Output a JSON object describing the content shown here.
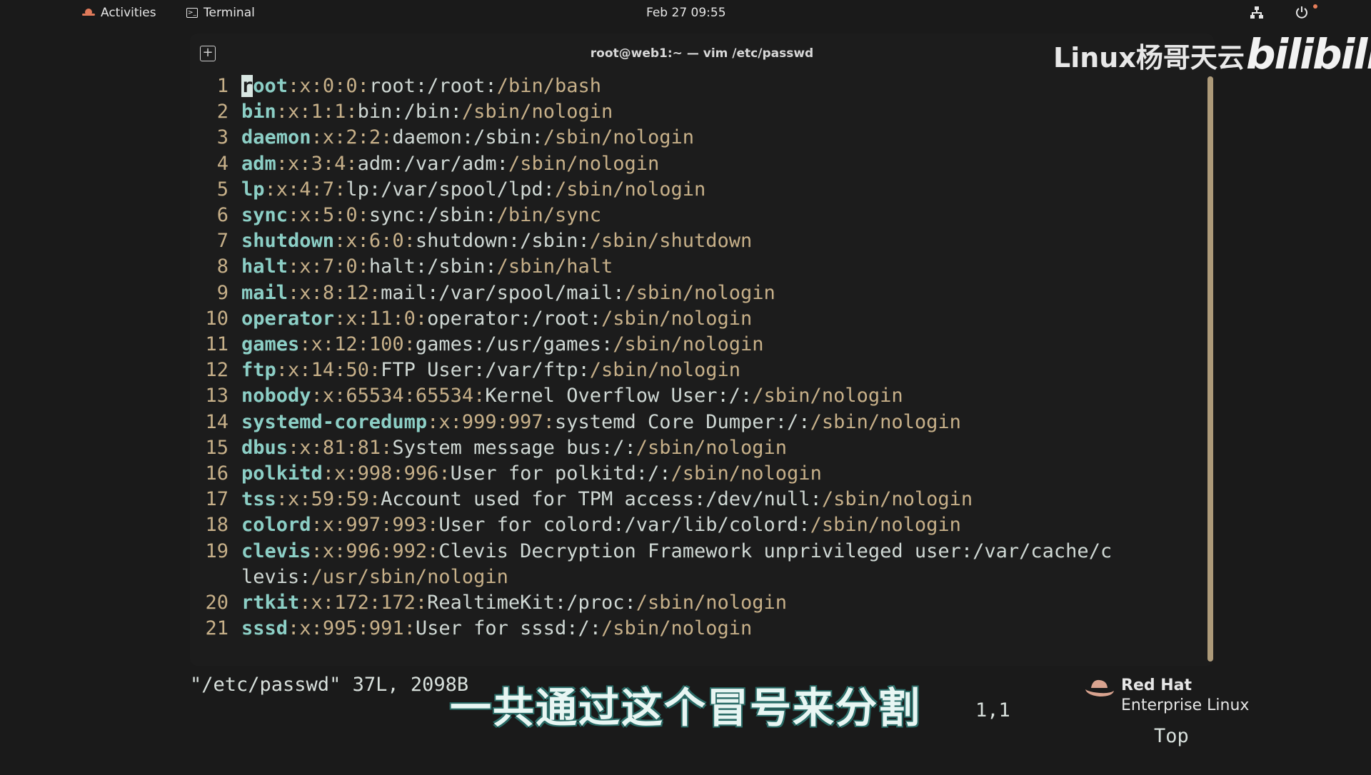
{
  "topbar": {
    "activities_label": "Activities",
    "app_label": "Terminal",
    "clock": "Feb 27  09:55"
  },
  "window": {
    "title": "root@web1:~ — vim /etc/passwd"
  },
  "watermark": {
    "text": "Linux杨哥天云",
    "logo": "bilibili"
  },
  "vim": {
    "lines": [
      {
        "num": "1",
        "user": "root",
        "rest": [
          [
            "s",
            ":x:"
          ],
          [
            "n",
            "0:0"
          ],
          [
            "s",
            ":"
          ],
          [
            "f",
            "root:/root:"
          ],
          [
            "sh",
            "/bin/bash"
          ]
        ]
      },
      {
        "num": "2",
        "user": "bin",
        "rest": [
          [
            "s",
            ":x:"
          ],
          [
            "n",
            "1:1"
          ],
          [
            "s",
            ":"
          ],
          [
            "f",
            "bin:/bin:"
          ],
          [
            "sh",
            "/sbin/nologin"
          ]
        ]
      },
      {
        "num": "3",
        "user": "daemon",
        "rest": [
          [
            "s",
            ":x:"
          ],
          [
            "n",
            "2:2"
          ],
          [
            "s",
            ":"
          ],
          [
            "f",
            "daemon:/sbin:"
          ],
          [
            "sh",
            "/sbin/nologin"
          ]
        ]
      },
      {
        "num": "4",
        "user": "adm",
        "rest": [
          [
            "s",
            ":x:"
          ],
          [
            "n",
            "3:4"
          ],
          [
            "s",
            ":"
          ],
          [
            "f",
            "adm:/var/adm:"
          ],
          [
            "sh",
            "/sbin/nologin"
          ]
        ]
      },
      {
        "num": "5",
        "user": "lp",
        "rest": [
          [
            "s",
            ":x:"
          ],
          [
            "n",
            "4:7"
          ],
          [
            "s",
            ":"
          ],
          [
            "f",
            "lp:/var/spool/lpd:"
          ],
          [
            "sh",
            "/sbin/nologin"
          ]
        ]
      },
      {
        "num": "6",
        "user": "sync",
        "rest": [
          [
            "s",
            ":x:"
          ],
          [
            "n",
            "5:0"
          ],
          [
            "s",
            ":"
          ],
          [
            "f",
            "sync:/sbin:"
          ],
          [
            "sh",
            "/bin/sync"
          ]
        ]
      },
      {
        "num": "7",
        "user": "shutdown",
        "rest": [
          [
            "s",
            ":x:"
          ],
          [
            "n",
            "6:0"
          ],
          [
            "s",
            ":"
          ],
          [
            "f",
            "shutdown:/sbin:"
          ],
          [
            "sh",
            "/sbin/shutdown"
          ]
        ]
      },
      {
        "num": "8",
        "user": "halt",
        "rest": [
          [
            "s",
            ":x:"
          ],
          [
            "n",
            "7:0"
          ],
          [
            "s",
            ":"
          ],
          [
            "f",
            "halt:/sbin:"
          ],
          [
            "sh",
            "/sbin/halt"
          ]
        ]
      },
      {
        "num": "9",
        "user": "mail",
        "rest": [
          [
            "s",
            ":x:"
          ],
          [
            "n",
            "8:12"
          ],
          [
            "s",
            ":"
          ],
          [
            "f",
            "mail:/var/spool/mail:"
          ],
          [
            "sh",
            "/sbin/nologin"
          ]
        ]
      },
      {
        "num": "10",
        "user": "operator",
        "rest": [
          [
            "s",
            ":x:"
          ],
          [
            "n",
            "11:0"
          ],
          [
            "s",
            ":"
          ],
          [
            "f",
            "operator:/root:"
          ],
          [
            "sh",
            "/sbin/nologin"
          ]
        ]
      },
      {
        "num": "11",
        "user": "games",
        "rest": [
          [
            "s",
            ":x:"
          ],
          [
            "n",
            "12:100"
          ],
          [
            "s",
            ":"
          ],
          [
            "f",
            "games:/usr/games:"
          ],
          [
            "sh",
            "/sbin/nologin"
          ]
        ]
      },
      {
        "num": "12",
        "user": "ftp",
        "rest": [
          [
            "s",
            ":x:"
          ],
          [
            "n",
            "14:50"
          ],
          [
            "s",
            ":"
          ],
          [
            "f",
            "FTP User:/var/ftp:"
          ],
          [
            "sh",
            "/sbin/nologin"
          ]
        ]
      },
      {
        "num": "13",
        "user": "nobody",
        "rest": [
          [
            "s",
            ":x:"
          ],
          [
            "n",
            "65534:65534"
          ],
          [
            "s",
            ":"
          ],
          [
            "f",
            "Kernel Overflow User:/:"
          ],
          [
            "sh",
            "/sbin/nologin"
          ]
        ]
      },
      {
        "num": "14",
        "user": "systemd-coredump",
        "rest": [
          [
            "s",
            ":x:"
          ],
          [
            "n",
            "999:997"
          ],
          [
            "s",
            ":"
          ],
          [
            "f",
            "systemd Core Dumper:/:"
          ],
          [
            "sh",
            "/sbin/nologin"
          ]
        ]
      },
      {
        "num": "15",
        "user": "dbus",
        "rest": [
          [
            "s",
            ":x:"
          ],
          [
            "n",
            "81:81"
          ],
          [
            "s",
            ":"
          ],
          [
            "f",
            "System message bus:/:"
          ],
          [
            "sh",
            "/sbin/nologin"
          ]
        ]
      },
      {
        "num": "16",
        "user": "polkitd",
        "rest": [
          [
            "s",
            ":x:"
          ],
          [
            "n",
            "998:996"
          ],
          [
            "s",
            ":"
          ],
          [
            "f",
            "User for polkitd:/:"
          ],
          [
            "sh",
            "/sbin/nologin"
          ]
        ]
      },
      {
        "num": "17",
        "user": "tss",
        "rest": [
          [
            "s",
            ":x:"
          ],
          [
            "n",
            "59:59"
          ],
          [
            "s",
            ":"
          ],
          [
            "f",
            "Account used for TPM access:/dev/null:"
          ],
          [
            "sh",
            "/sbin/nologin"
          ]
        ]
      },
      {
        "num": "18",
        "user": "colord",
        "rest": [
          [
            "s",
            ":x:"
          ],
          [
            "n",
            "997:993"
          ],
          [
            "s",
            ":"
          ],
          [
            "f",
            "User for colord:/var/lib/colord:"
          ],
          [
            "sh",
            "/sbin/nologin"
          ]
        ]
      },
      {
        "num": "19",
        "user": "clevis",
        "rest": [
          [
            "s",
            ":x:"
          ],
          [
            "n",
            "996:992"
          ],
          [
            "s",
            ":"
          ],
          [
            "f",
            "Clevis Decryption Framework unprivileged user:/var/cache/c"
          ]
        ]
      },
      {
        "num": "",
        "user": "",
        "rest": [
          [
            "f",
            "levis:"
          ],
          [
            "sh",
            "/usr/sbin/nologin"
          ]
        ]
      },
      {
        "num": "20",
        "user": "rtkit",
        "rest": [
          [
            "s",
            ":x:"
          ],
          [
            "n",
            "172:172"
          ],
          [
            "s",
            ":"
          ],
          [
            "f",
            "RealtimeKit:/proc:"
          ],
          [
            "sh",
            "/sbin/nologin"
          ]
        ]
      },
      {
        "num": "21",
        "user": "sssd",
        "rest": [
          [
            "s",
            ":x:"
          ],
          [
            "n",
            "995:991"
          ],
          [
            "s",
            ":"
          ],
          [
            "f",
            "User for sssd:/:"
          ],
          [
            "sh",
            "/sbin/nologin"
          ]
        ]
      }
    ],
    "status_file": "\"/etc/passwd\" 37L, 2098B",
    "status_pos": "1,1",
    "status_scroll": "Top"
  },
  "subtitle": "一共通过这个冒号来分割",
  "branding": {
    "name": "Red Hat",
    "product": "Enterprise Linux"
  }
}
